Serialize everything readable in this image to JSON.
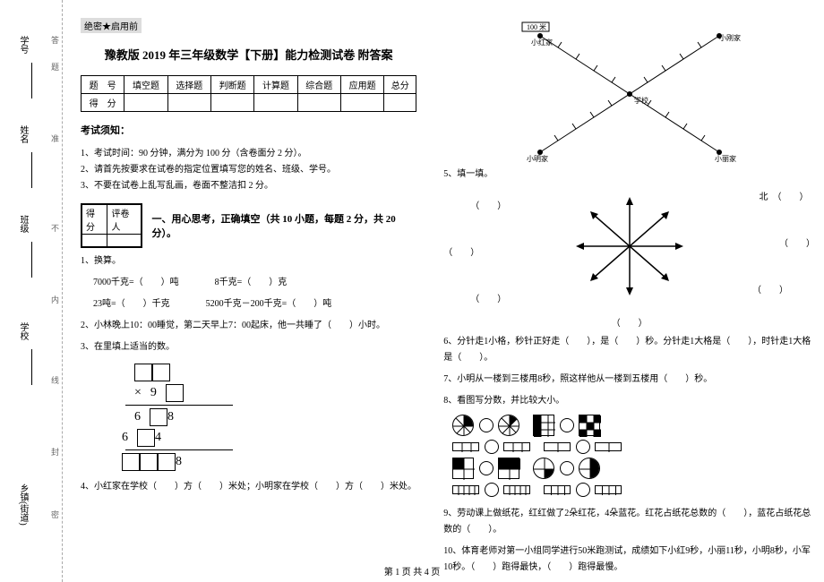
{
  "binding": {
    "labels": [
      "学号",
      "姓名",
      "班级",
      "学校",
      "乡镇(街道)"
    ],
    "side": [
      "答",
      "题",
      "准",
      "不",
      "内",
      "线",
      "封",
      "密"
    ]
  },
  "header": {
    "tag": "绝密★启用前",
    "title": "豫教版 2019 年三年级数学【下册】能力检测试卷 附答案"
  },
  "scoreTable": {
    "headers": [
      "题　号",
      "填空题",
      "选择题",
      "判断题",
      "计算题",
      "综合题",
      "应用题",
      "总分"
    ],
    "row2": "得　分"
  },
  "notice": {
    "heading": "考试须知：",
    "items": [
      "1、考试时间：90 分钟，满分为 100 分（含卷面分 2 分）。",
      "2、请首先按要求在试卷的指定位置填写您的姓名、班级、学号。",
      "3、不要在试卷上乱写乱画，卷面不整洁扣 2 分。"
    ]
  },
  "scorebox": {
    "c1": "得分",
    "c2": "评卷人"
  },
  "section1": {
    "title": "一、用心思考，正确填空（共 10 小题，每题 2 分，共 20 分）。",
    "q1": "1、换算。",
    "q1a": "7000千克=（　　）吨",
    "q1b": "8千克=（　　）克",
    "q1c": "23吨=（　　）千克",
    "q1d": "5200千克－200千克=（　　）吨",
    "q2": "2、小林晚上10：00睡觉，第二天早上7：00起床，他一共睡了（　　）小时。",
    "q3": "3、在里填上适当的数。",
    "mult_sign": "×",
    "mult_9": "9",
    "r1a": "6",
    "r1b": "8",
    "r2a": "6",
    "r2b": "4",
    "r3": "8",
    "q4": "4、小红家在学校（　　）方（　　）米处；小明家在学校（　　）方（　　）米处。"
  },
  "right": {
    "scale": "100 米",
    "labels": {
      "xh": "小红家",
      "xm": "小明家",
      "xg": "小刚家",
      "xl": "小丽家",
      "school": "学校"
    },
    "q5": "5、填一填。",
    "north": "北",
    "blank": "（　　）",
    "q6": "6、分针走1小格，秒针正好走（　　），是（　　）秒。分针走1大格是（　　），时针走1大格是（　　）。",
    "q7": "7、小明从一楼到三楼用8秒，照这样他从一楼到五楼用（　　）秒。",
    "q8": "8、看图写分数，并比较大小。",
    "q9": "9、劳动课上做纸花，红红做了2朵红花，4朵蓝花。红花占纸花总数的（　　），蓝花占纸花总数的（　　）。",
    "q10": "10、体育老师对第一小组同学进行50米跑测试，成绩如下小红9秒，小丽11秒，小明8秒，小军10秒。（　　）跑得最快，（　　）跑得最慢。"
  },
  "footer": "第 1 页 共 4 页"
}
